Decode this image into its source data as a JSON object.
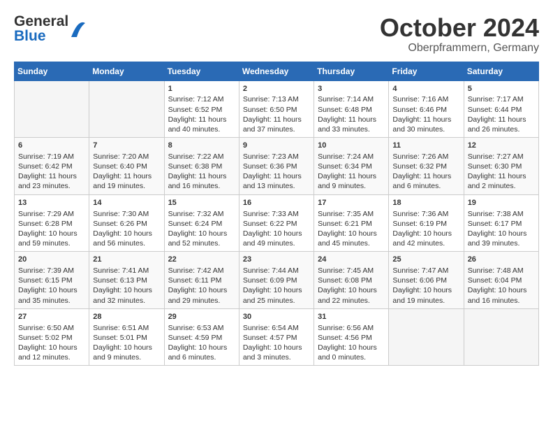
{
  "header": {
    "logo_general": "General",
    "logo_blue": "Blue",
    "month_title": "October 2024",
    "location": "Oberpframmern, Germany"
  },
  "weekdays": [
    "Sunday",
    "Monday",
    "Tuesday",
    "Wednesday",
    "Thursday",
    "Friday",
    "Saturday"
  ],
  "weeks": [
    [
      {
        "day": "",
        "empty": true
      },
      {
        "day": "",
        "empty": true
      },
      {
        "day": "1",
        "line1": "Sunrise: 7:12 AM",
        "line2": "Sunset: 6:52 PM",
        "line3": "Daylight: 11 hours",
        "line4": "and 40 minutes."
      },
      {
        "day": "2",
        "line1": "Sunrise: 7:13 AM",
        "line2": "Sunset: 6:50 PM",
        "line3": "Daylight: 11 hours",
        "line4": "and 37 minutes."
      },
      {
        "day": "3",
        "line1": "Sunrise: 7:14 AM",
        "line2": "Sunset: 6:48 PM",
        "line3": "Daylight: 11 hours",
        "line4": "and 33 minutes."
      },
      {
        "day": "4",
        "line1": "Sunrise: 7:16 AM",
        "line2": "Sunset: 6:46 PM",
        "line3": "Daylight: 11 hours",
        "line4": "and 30 minutes."
      },
      {
        "day": "5",
        "line1": "Sunrise: 7:17 AM",
        "line2": "Sunset: 6:44 PM",
        "line3": "Daylight: 11 hours",
        "line4": "and 26 minutes."
      }
    ],
    [
      {
        "day": "6",
        "line1": "Sunrise: 7:19 AM",
        "line2": "Sunset: 6:42 PM",
        "line3": "Daylight: 11 hours",
        "line4": "and 23 minutes."
      },
      {
        "day": "7",
        "line1": "Sunrise: 7:20 AM",
        "line2": "Sunset: 6:40 PM",
        "line3": "Daylight: 11 hours",
        "line4": "and 19 minutes."
      },
      {
        "day": "8",
        "line1": "Sunrise: 7:22 AM",
        "line2": "Sunset: 6:38 PM",
        "line3": "Daylight: 11 hours",
        "line4": "and 16 minutes."
      },
      {
        "day": "9",
        "line1": "Sunrise: 7:23 AM",
        "line2": "Sunset: 6:36 PM",
        "line3": "Daylight: 11 hours",
        "line4": "and 13 minutes."
      },
      {
        "day": "10",
        "line1": "Sunrise: 7:24 AM",
        "line2": "Sunset: 6:34 PM",
        "line3": "Daylight: 11 hours",
        "line4": "and 9 minutes."
      },
      {
        "day": "11",
        "line1": "Sunrise: 7:26 AM",
        "line2": "Sunset: 6:32 PM",
        "line3": "Daylight: 11 hours",
        "line4": "and 6 minutes."
      },
      {
        "day": "12",
        "line1": "Sunrise: 7:27 AM",
        "line2": "Sunset: 6:30 PM",
        "line3": "Daylight: 11 hours",
        "line4": "and 2 minutes."
      }
    ],
    [
      {
        "day": "13",
        "line1": "Sunrise: 7:29 AM",
        "line2": "Sunset: 6:28 PM",
        "line3": "Daylight: 10 hours",
        "line4": "and 59 minutes."
      },
      {
        "day": "14",
        "line1": "Sunrise: 7:30 AM",
        "line2": "Sunset: 6:26 PM",
        "line3": "Daylight: 10 hours",
        "line4": "and 56 minutes."
      },
      {
        "day": "15",
        "line1": "Sunrise: 7:32 AM",
        "line2": "Sunset: 6:24 PM",
        "line3": "Daylight: 10 hours",
        "line4": "and 52 minutes."
      },
      {
        "day": "16",
        "line1": "Sunrise: 7:33 AM",
        "line2": "Sunset: 6:22 PM",
        "line3": "Daylight: 10 hours",
        "line4": "and 49 minutes."
      },
      {
        "day": "17",
        "line1": "Sunrise: 7:35 AM",
        "line2": "Sunset: 6:21 PM",
        "line3": "Daylight: 10 hours",
        "line4": "and 45 minutes."
      },
      {
        "day": "18",
        "line1": "Sunrise: 7:36 AM",
        "line2": "Sunset: 6:19 PM",
        "line3": "Daylight: 10 hours",
        "line4": "and 42 minutes."
      },
      {
        "day": "19",
        "line1": "Sunrise: 7:38 AM",
        "line2": "Sunset: 6:17 PM",
        "line3": "Daylight: 10 hours",
        "line4": "and 39 minutes."
      }
    ],
    [
      {
        "day": "20",
        "line1": "Sunrise: 7:39 AM",
        "line2": "Sunset: 6:15 PM",
        "line3": "Daylight: 10 hours",
        "line4": "and 35 minutes."
      },
      {
        "day": "21",
        "line1": "Sunrise: 7:41 AM",
        "line2": "Sunset: 6:13 PM",
        "line3": "Daylight: 10 hours",
        "line4": "and 32 minutes."
      },
      {
        "day": "22",
        "line1": "Sunrise: 7:42 AM",
        "line2": "Sunset: 6:11 PM",
        "line3": "Daylight: 10 hours",
        "line4": "and 29 minutes."
      },
      {
        "day": "23",
        "line1": "Sunrise: 7:44 AM",
        "line2": "Sunset: 6:09 PM",
        "line3": "Daylight: 10 hours",
        "line4": "and 25 minutes."
      },
      {
        "day": "24",
        "line1": "Sunrise: 7:45 AM",
        "line2": "Sunset: 6:08 PM",
        "line3": "Daylight: 10 hours",
        "line4": "and 22 minutes."
      },
      {
        "day": "25",
        "line1": "Sunrise: 7:47 AM",
        "line2": "Sunset: 6:06 PM",
        "line3": "Daylight: 10 hours",
        "line4": "and 19 minutes."
      },
      {
        "day": "26",
        "line1": "Sunrise: 7:48 AM",
        "line2": "Sunset: 6:04 PM",
        "line3": "Daylight: 10 hours",
        "line4": "and 16 minutes."
      }
    ],
    [
      {
        "day": "27",
        "line1": "Sunrise: 6:50 AM",
        "line2": "Sunset: 5:02 PM",
        "line3": "Daylight: 10 hours",
        "line4": "and 12 minutes."
      },
      {
        "day": "28",
        "line1": "Sunrise: 6:51 AM",
        "line2": "Sunset: 5:01 PM",
        "line3": "Daylight: 10 hours",
        "line4": "and 9 minutes."
      },
      {
        "day": "29",
        "line1": "Sunrise: 6:53 AM",
        "line2": "Sunset: 4:59 PM",
        "line3": "Daylight: 10 hours",
        "line4": "and 6 minutes."
      },
      {
        "day": "30",
        "line1": "Sunrise: 6:54 AM",
        "line2": "Sunset: 4:57 PM",
        "line3": "Daylight: 10 hours",
        "line4": "and 3 minutes."
      },
      {
        "day": "31",
        "line1": "Sunrise: 6:56 AM",
        "line2": "Sunset: 4:56 PM",
        "line3": "Daylight: 10 hours",
        "line4": "and 0 minutes."
      },
      {
        "day": "",
        "empty": true
      },
      {
        "day": "",
        "empty": true
      }
    ]
  ]
}
